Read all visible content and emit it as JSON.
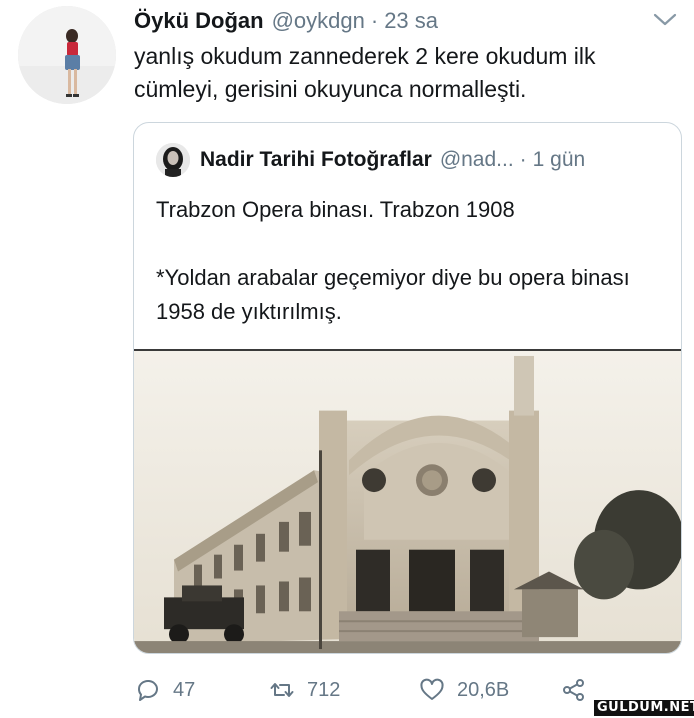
{
  "tweet": {
    "author_name": "Öykü Doğan",
    "handle": "@oykdgn",
    "separator": "·",
    "time": "23 sa",
    "text": "yanlış okudum zannederek 2 kere okudum ilk cümleyi, gerisini okuyunca normalleşti.",
    "more_icon": "chevron-down-icon"
  },
  "quoted": {
    "author_name": "Nadir Tarihi Fotoğraflar",
    "handle": "@nad...",
    "separator": "·",
    "time": "1 gün",
    "line1": "Trabzon Opera binası. Trabzon 1908",
    "line2": "*Yoldan arabalar geçemiyor diye bu opera binası 1958 de yıktırılmış."
  },
  "actions": {
    "reply_count": "47",
    "retweet_count": "712",
    "like_count": "20,6B",
    "reply_icon": "reply-icon",
    "retweet_icon": "retweet-icon",
    "like_icon": "heart-icon",
    "share_icon": "share-icon"
  },
  "watermark": "GULDUM.NET",
  "colors": {
    "text": "#14171a",
    "secondary": "#657786",
    "border": "#ccd6dd"
  }
}
